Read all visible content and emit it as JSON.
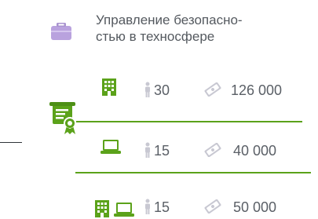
{
  "title": {
    "line1": "Управление безопасно-",
    "line2": "стью в техносфере"
  },
  "rows": [
    {
      "people": "30",
      "cost": "126 000"
    },
    {
      "people": "15",
      "cost": "40 000"
    },
    {
      "people": "15",
      "cost": "50 000"
    }
  ],
  "icons": {
    "category": "briefcase-icon",
    "certificate": "certificate-icon",
    "row1": "office-building-icon",
    "row2": "laptop-icon",
    "row3_a": "office-building-icon",
    "row3_b": "laptop-icon",
    "people": "person-icon",
    "cost": "money-icon"
  },
  "colors": {
    "accent_green": "#5ba21a",
    "briefcase_purple": "#b9a2de",
    "text": "#54595f",
    "muted_icon": "#c8c8d2"
  }
}
